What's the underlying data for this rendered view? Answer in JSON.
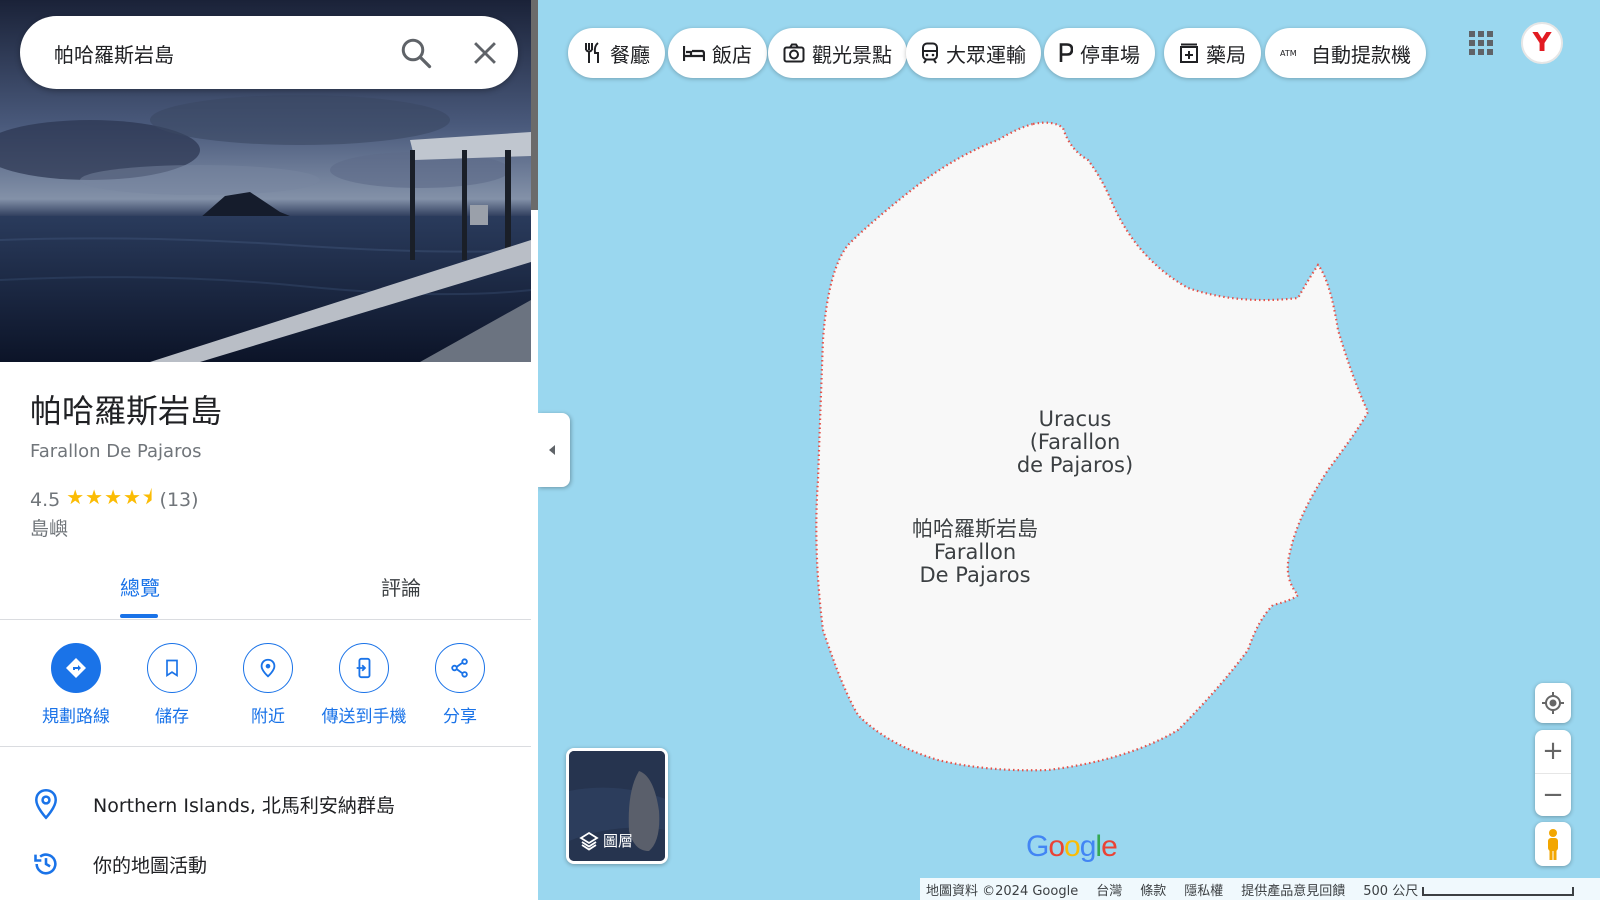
{
  "search": {
    "value": "帕哈羅斯岩島",
    "placeholder": ""
  },
  "place": {
    "title": "帕哈羅斯岩島",
    "subtitle": "Farallon De Pajaros",
    "rating": "4.5",
    "stars": "★★★★⯨",
    "review_count": "(13)",
    "category": "島嶼"
  },
  "tabs": [
    {
      "label": "總覽",
      "active": true
    },
    {
      "label": "評論",
      "active": false
    }
  ],
  "actions": [
    {
      "label": "規劃路線",
      "icon": "directions-icon"
    },
    {
      "label": "儲存",
      "icon": "bookmark-icon"
    },
    {
      "label": "附近",
      "icon": "nearby-icon"
    },
    {
      "label": "傳送到手機",
      "icon": "send-to-phone-icon"
    },
    {
      "label": "分享",
      "icon": "share-icon"
    }
  ],
  "info": {
    "address": "Northern Islands, 北馬利安納群島",
    "activity": "你的地圖活動"
  },
  "chips": [
    {
      "label": "餐廳",
      "icon": "restaurant-icon"
    },
    {
      "label": "飯店",
      "icon": "hotel-icon"
    },
    {
      "label": "觀光景點",
      "icon": "camera-icon"
    },
    {
      "label": "大眾運輸",
      "icon": "transit-icon"
    },
    {
      "label": "停車場",
      "icon": "parking-icon"
    },
    {
      "label": "藥局",
      "icon": "pharmacy-icon"
    },
    {
      "label": "自動提款機",
      "icon": "atm-icon"
    }
  ],
  "avatar_letter": "Y",
  "map_labels": {
    "uracus_line1": "Uracus",
    "uracus_line2": "(Farallon",
    "uracus_line3": "de Pajaros)",
    "place_line1": "帕哈羅斯岩島",
    "place_line2": "Farallon",
    "place_line3": "De Pajaros"
  },
  "layers_label": "圖層",
  "google_logo": "Google",
  "footer": {
    "map_data": "地圖資料 ©2024 Google",
    "region": "台灣",
    "terms": "條款",
    "privacy": "隱私權",
    "feedback": "提供產品意見回饋",
    "scale": "500 公尺"
  },
  "colors": {
    "accent": "#1a73e8",
    "water": "#9ad7ef",
    "land": "#f8f8f8",
    "border": "#e5534b",
    "star": "#fbbc04"
  }
}
